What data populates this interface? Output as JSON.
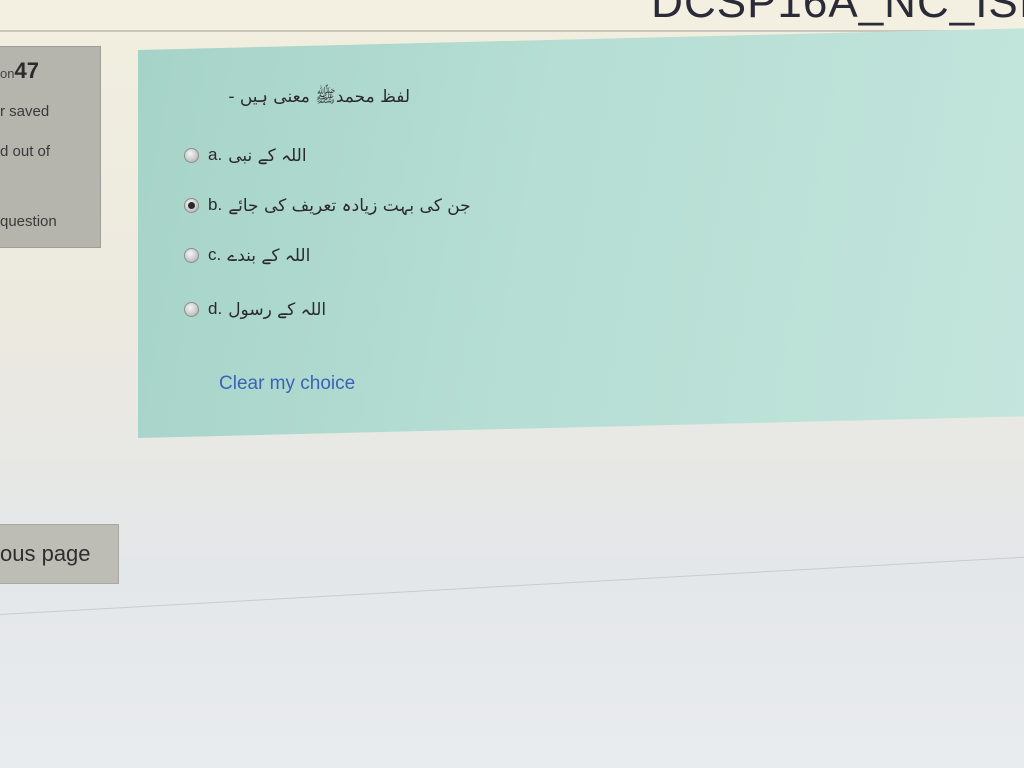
{
  "header": {
    "course_code": "DCSP16A_NC_ISI"
  },
  "question_info": {
    "number_prefix": "on",
    "number": "47",
    "status": "r saved",
    "marks": "d out of",
    "flag_label": "question"
  },
  "question": {
    "text": "لفظ محمدﷺ معنی ہیں -",
    "options": [
      {
        "letter": "a.",
        "text": "اللہ کے نبی",
        "selected": false
      },
      {
        "letter": "b.",
        "text": "جن کی بہت زیادہ تعریف کی جائے",
        "selected": true
      },
      {
        "letter": "c.",
        "text": "اللہ کے بندے",
        "selected": false
      },
      {
        "letter": "d.",
        "text": "اللہ کے رسول",
        "selected": false
      }
    ],
    "clear_label": "Clear my choice"
  },
  "navigation": {
    "previous_label": "ous page"
  }
}
